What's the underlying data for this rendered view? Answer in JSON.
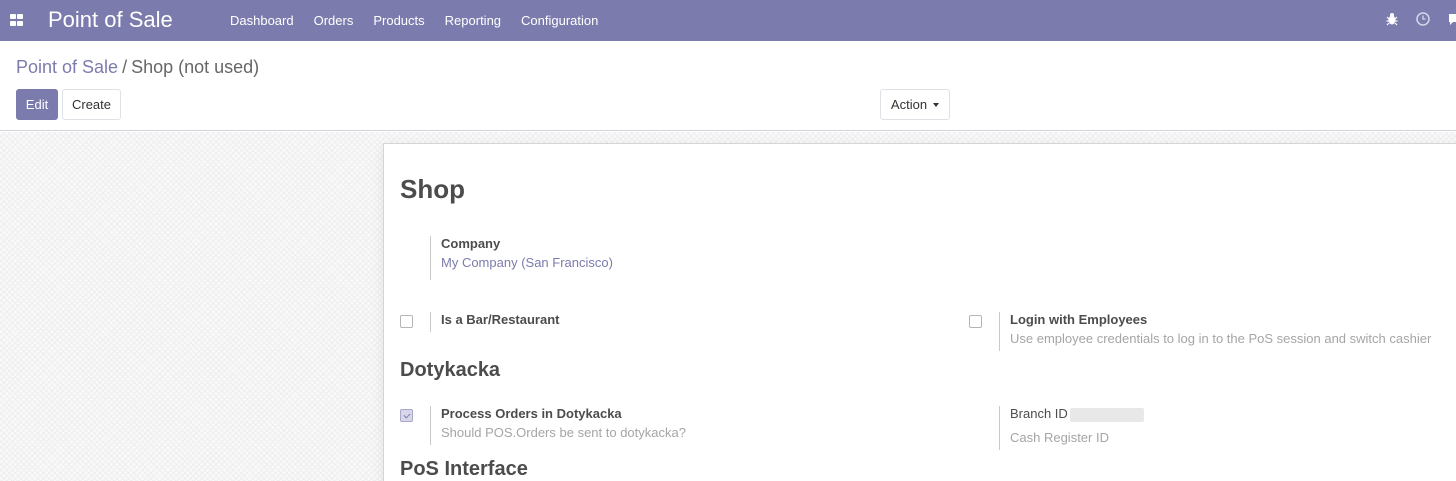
{
  "navbar": {
    "app_title": "Point of Sale",
    "menu": [
      "Dashboard",
      "Orders",
      "Products",
      "Reporting",
      "Configuration"
    ],
    "icons": [
      "apps-icon",
      "bug-icon",
      "clock-icon",
      "chat-icon"
    ]
  },
  "breadcrumb": {
    "parent": "Point of Sale",
    "separator": "/",
    "current": "Shop (not used)"
  },
  "toolbar": {
    "edit_label": "Edit",
    "create_label": "Create",
    "action_label": "Action"
  },
  "form": {
    "title": "Shop",
    "company": {
      "label": "Company",
      "value": "My Company (San Francisco)"
    },
    "is_bar_restaurant": {
      "label": "Is a Bar/Restaurant",
      "checked": false
    },
    "login_employees": {
      "label": "Login with Employees",
      "help": "Use employee credentials to log in to the PoS session and switch cashier",
      "checked": false
    },
    "dotykacka_section": "Dotykacka",
    "process_orders": {
      "label": "Process Orders in Dotykacka",
      "help": "Should POS.Orders be sent to dotykacka?",
      "checked": true
    },
    "branch_id": {
      "label": "Branch ID"
    },
    "cash_register_id": {
      "label": "Cash Register ID"
    },
    "pos_interface_section": "PoS Interface"
  },
  "colors": {
    "brand": "#7c7bad",
    "text": "#4c4c4c",
    "muted": "#a5a5a5"
  }
}
